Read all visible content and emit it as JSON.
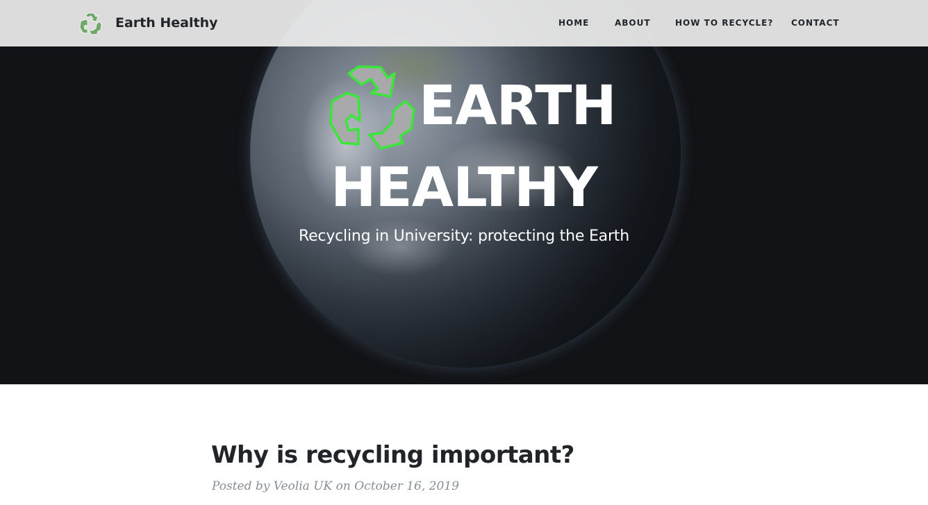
{
  "navbar": {
    "brand_name": "Earth Healthy",
    "brand_icon": "recycle-icon",
    "links": [
      {
        "label": "HOME"
      },
      {
        "label": "ABOUT"
      },
      {
        "label": "HOW TO RECYCLE?"
      },
      {
        "label": "CONTACT"
      }
    ]
  },
  "hero": {
    "title_line1": "EARTH",
    "title_line2": "HEALTHY",
    "subtitle": "Recycling in University: protecting the Earth",
    "logo_icon": "recycle-icon",
    "background": "earth-from-space"
  },
  "post": {
    "title": "Why is recycling important?",
    "meta_prefix": "Posted by",
    "author": "Veolia UK",
    "meta_on": "on",
    "date": "October 16, 2019"
  },
  "colors": {
    "logo_green": "#39e639",
    "logo_gray": "#a9a9ab",
    "text_dark": "#212529",
    "meta_gray": "#868e96"
  }
}
